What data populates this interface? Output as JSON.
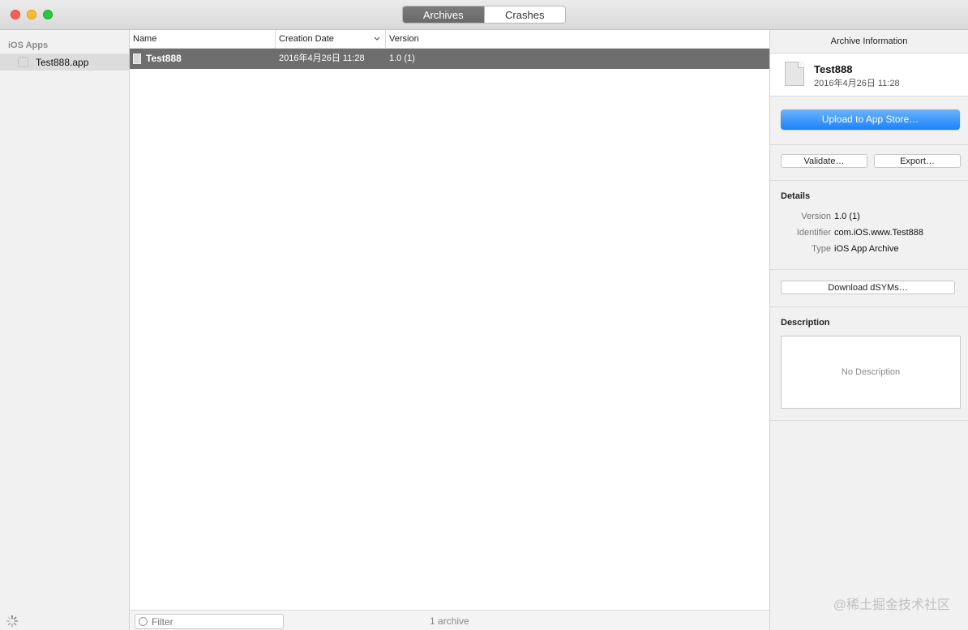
{
  "toolbar": {
    "tabs": [
      {
        "label": "Archives",
        "active": true
      },
      {
        "label": "Crashes",
        "active": false
      }
    ]
  },
  "sidebar": {
    "section": "iOS Apps",
    "items": [
      {
        "label": "Test888.app",
        "selected": true
      }
    ]
  },
  "list": {
    "columns": [
      "Name",
      "Creation Date",
      "Version"
    ],
    "rows": [
      {
        "name": "Test888",
        "date": "2016年4月26日 11:28",
        "version": "1.0 (1)"
      }
    ]
  },
  "bottom": {
    "filter_placeholder": "Filter",
    "count": "1 archive"
  },
  "inspector": {
    "title": "Archive Information",
    "name": "Test888",
    "date": "2016年4月26日 11:28",
    "upload_label": "Upload to App Store…",
    "validate_label": "Validate…",
    "export_label": "Export…",
    "details_title": "Details",
    "details": [
      {
        "label": "Version",
        "value": "1.0 (1)"
      },
      {
        "label": "Identifier",
        "value": "com.iOS.www.Test888"
      },
      {
        "label": "Type",
        "value": "iOS App Archive"
      }
    ],
    "dsym_label": "Download dSYMs…",
    "description_title": "Description",
    "description_empty": "No Description"
  },
  "watermark": "@稀土掘金技术社区",
  "colors": {
    "accent": "#1a82fb",
    "selection": "#6e6e6e"
  }
}
